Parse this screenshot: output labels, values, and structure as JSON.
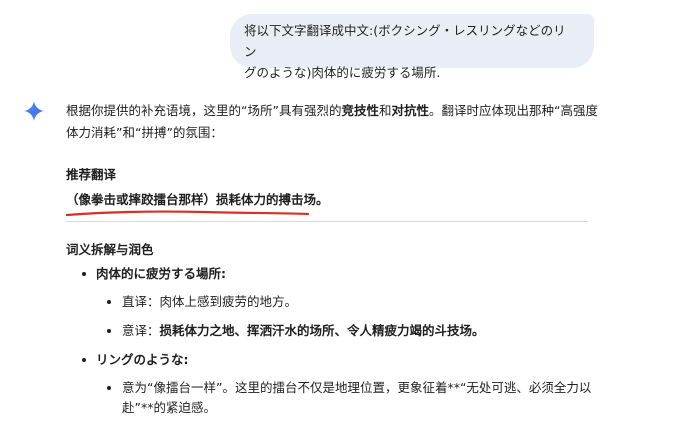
{
  "user_message": {
    "line1": "将以下文字翻译成中文:(ボクシング・レスリングなどのリン",
    "line2": "グのような)肉体的に疲労する場所."
  },
  "assistant": {
    "intro": {
      "p1": "根据你提供的补充语境，这里的“场所”具有强烈的",
      "b1": "竞技性",
      "p2": "和",
      "b2": "对抗性",
      "p3": "。翻译时应体现出那种“高强度",
      "line2": "体力消耗”和“拼搏”的氛围："
    },
    "recommended_heading": "推荐翻译",
    "recommended_translation": "（像拳击或摔跤擂台那样）损耗体力的搏击场。",
    "lexical_heading": "词义拆解与润色",
    "items": [
      {
        "term": "肉体的に疲労する場所:",
        "subs": [
          {
            "label": "直译：",
            "text": "肉体上感到疲劳的地方。",
            "bold": false
          },
          {
            "label": "意译：",
            "text": "损耗体力之地、挥洒汗水的场所、令人精疲力竭的斗技场。",
            "bold": true
          }
        ]
      },
      {
        "term": "リングのような:",
        "subs": [
          {
            "label": "",
            "text": "意为“像擂台一样”。这里的擂台不仅是地理位置，更象征着**“无处可逃、必须全力以",
            "text2": "赴”**的紧迫感。",
            "bold": false
          }
        ]
      }
    ]
  },
  "colors": {
    "bubble": "#e9eef6",
    "underline": "#d93025",
    "spark_blue": "#4f86f7"
  }
}
